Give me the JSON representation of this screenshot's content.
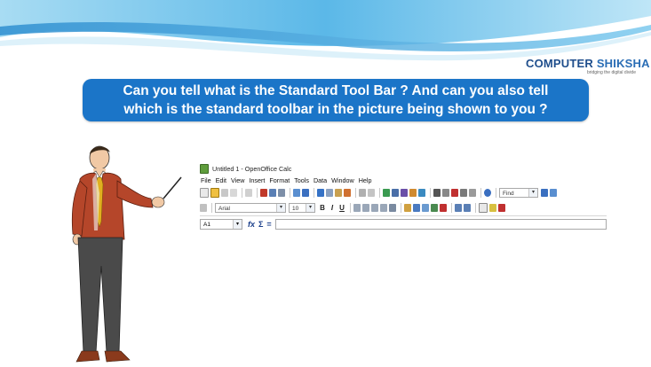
{
  "logo": {
    "brand_part1": "COMPUTER ",
    "brand_part2": "SHIKSHA",
    "tagline": "bridging the digital divide"
  },
  "banner": {
    "line1": "Can you tell what is the Standard Tool Bar ? And can you also tell",
    "line2": "which is the standard toolbar in the picture being shown to you ?"
  },
  "calc_window": {
    "title": "Untitled 1 - OpenOffice Calc",
    "menu": [
      {
        "label": "File"
      },
      {
        "label": "Edit"
      },
      {
        "label": "View"
      },
      {
        "label": "Insert"
      },
      {
        "label": "Format"
      },
      {
        "label": "Tools"
      },
      {
        "label": "Data"
      },
      {
        "label": "Window"
      },
      {
        "label": "Help"
      }
    ],
    "find_placeholder": "Find",
    "font_name": "Arial",
    "font_size": "10",
    "bold_label": "B",
    "italic_label": "I",
    "underline_label": "U",
    "name_box": "A1",
    "equals_label": "="
  },
  "colors": {
    "banner": "#1b75c8",
    "wave": "#6ec3ea"
  }
}
